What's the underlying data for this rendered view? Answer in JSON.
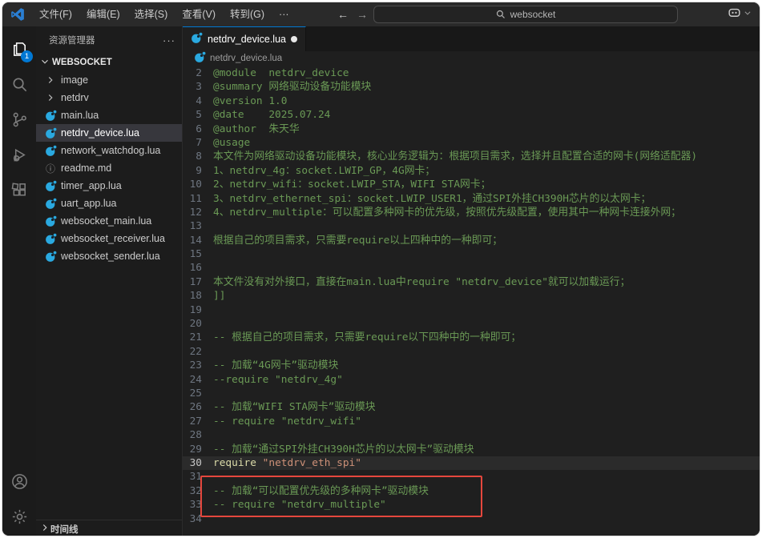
{
  "titlebar": {
    "menus": [
      "文件(F)",
      "编辑(E)",
      "选择(S)",
      "查看(V)",
      "转到(G)",
      "···"
    ],
    "nav_back": "←",
    "nav_forward": "→",
    "search_value": "websocket"
  },
  "activity_bar": {
    "explorer_badge": "1",
    "items": [
      {
        "name": "explorer",
        "active": true
      },
      {
        "name": "search",
        "active": false
      },
      {
        "name": "source-control",
        "active": false
      },
      {
        "name": "run-debug",
        "active": false
      },
      {
        "name": "extensions",
        "active": false
      }
    ],
    "bottom_items": [
      {
        "name": "account"
      },
      {
        "name": "settings"
      }
    ]
  },
  "sidebar": {
    "title": "资源管理器",
    "more_actions": "···",
    "root_folder": "WEBSOCKET",
    "items": [
      {
        "label": "image",
        "type": "folder"
      },
      {
        "label": "netdrv",
        "type": "folder"
      },
      {
        "label": "main.lua",
        "type": "lua"
      },
      {
        "label": "netdrv_device.lua",
        "type": "lua",
        "selected": true
      },
      {
        "label": "network_watchdog.lua",
        "type": "lua"
      },
      {
        "label": "readme.md",
        "type": "info"
      },
      {
        "label": "timer_app.lua",
        "type": "lua"
      },
      {
        "label": "uart_app.lua",
        "type": "lua"
      },
      {
        "label": "websocket_main.lua",
        "type": "lua"
      },
      {
        "label": "websocket_receiver.lua",
        "type": "lua"
      },
      {
        "label": "websocket_sender.lua",
        "type": "lua"
      }
    ],
    "timeline_label": "时间线"
  },
  "editor": {
    "tab": {
      "label": "netdrv_device.lua",
      "dirty": true
    },
    "breadcrumb": "netdrv_device.lua",
    "annotation": {
      "type": "red-box",
      "highlighted_lines": "29-30"
    },
    "lines": [
      {
        "n": 2,
        "tokens": [
          {
            "c": "comment",
            "t": "@module  netdrv_device"
          }
        ]
      },
      {
        "n": 3,
        "tokens": [
          {
            "c": "comment",
            "t": "@summary 网络驱动设备功能模块"
          }
        ]
      },
      {
        "n": 4,
        "tokens": [
          {
            "c": "comment",
            "t": "@version 1.0"
          }
        ]
      },
      {
        "n": 5,
        "tokens": [
          {
            "c": "comment",
            "t": "@date    2025.07.24"
          }
        ]
      },
      {
        "n": 6,
        "tokens": [
          {
            "c": "comment",
            "t": "@author  朱天华"
          }
        ]
      },
      {
        "n": 7,
        "tokens": [
          {
            "c": "comment",
            "t": "@usage"
          }
        ]
      },
      {
        "n": 8,
        "tokens": [
          {
            "c": "comment",
            "t": "本文件为网络驱动设备功能模块，核心业务逻辑为：根据项目需求，选择并且配置合适的网卡(网络适配器)"
          }
        ]
      },
      {
        "n": 9,
        "tokens": [
          {
            "c": "comment",
            "t": "1、netdrv_4g：socket.LWIP_GP，4G网卡；"
          }
        ]
      },
      {
        "n": 10,
        "tokens": [
          {
            "c": "comment",
            "t": "2、netdrv_wifi：socket.LWIP_STA，WIFI STA网卡；"
          }
        ]
      },
      {
        "n": 11,
        "tokens": [
          {
            "c": "comment",
            "t": "3、netdrv_ethernet_spi：socket.LWIP_USER1，通过SPI外挂CH390H芯片的以太网卡；"
          }
        ]
      },
      {
        "n": 12,
        "tokens": [
          {
            "c": "comment",
            "t": "4、netdrv_multiple：可以配置多种网卡的优先级，按照优先级配置，使用其中一种网卡连接外网；"
          }
        ]
      },
      {
        "n": 13,
        "tokens": []
      },
      {
        "n": 14,
        "tokens": [
          {
            "c": "comment",
            "t": "根据自己的项目需求，只需要require以上四种中的一种即可；"
          }
        ]
      },
      {
        "n": 15,
        "tokens": []
      },
      {
        "n": 16,
        "tokens": []
      },
      {
        "n": 17,
        "tokens": [
          {
            "c": "comment",
            "t": "本文件没有对外接口，直接在main.lua中require \"netdrv_device\"就可以加载运行；"
          }
        ]
      },
      {
        "n": 18,
        "tokens": [
          {
            "c": "comment",
            "t": "]]"
          }
        ]
      },
      {
        "n": 19,
        "tokens": []
      },
      {
        "n": 20,
        "tokens": []
      },
      {
        "n": 21,
        "tokens": [
          {
            "c": "comment",
            "t": "-- 根据自己的项目需求，只需要require以下四种中的一种即可；"
          }
        ]
      },
      {
        "n": 22,
        "tokens": []
      },
      {
        "n": 23,
        "tokens": [
          {
            "c": "comment",
            "t": "-- 加载“4G网卡”驱动模块"
          }
        ]
      },
      {
        "n": 24,
        "tokens": [
          {
            "c": "comment",
            "t": "--require \"netdrv_4g\""
          }
        ]
      },
      {
        "n": 25,
        "tokens": []
      },
      {
        "n": 26,
        "tokens": [
          {
            "c": "comment",
            "t": "-- 加载“WIFI STA网卡”驱动模块"
          }
        ]
      },
      {
        "n": 27,
        "tokens": [
          {
            "c": "comment",
            "t": "-- require \"netdrv_wifi\""
          }
        ]
      },
      {
        "n": 28,
        "tokens": []
      },
      {
        "n": 29,
        "tokens": [
          {
            "c": "comment",
            "t": "-- 加载“通过SPI外挂CH390H芯片的以太网卡”驱动模块"
          }
        ]
      },
      {
        "n": 30,
        "current": true,
        "tokens": [
          {
            "c": "keyword",
            "t": "require"
          },
          {
            "c": "plain",
            "t": " "
          },
          {
            "c": "string",
            "t": "\"netdrv_eth_spi\""
          }
        ]
      },
      {
        "n": 31,
        "tokens": []
      },
      {
        "n": 32,
        "tokens": [
          {
            "c": "comment",
            "t": "-- 加载“可以配置优先级的多种网卡”驱动模块"
          }
        ]
      },
      {
        "n": 33,
        "tokens": [
          {
            "c": "comment",
            "t": "-- require \"netdrv_multiple\""
          }
        ]
      },
      {
        "n": 34,
        "tokens": []
      }
    ]
  },
  "colors": {
    "accent_blue": "#0078d4",
    "annotation_red": "#e5473d",
    "comment_green": "#6a9955",
    "keyword_yellow": "#dcdcaa",
    "string_orange": "#ce9178",
    "lua_icon_blue": "#2aa9e0"
  }
}
